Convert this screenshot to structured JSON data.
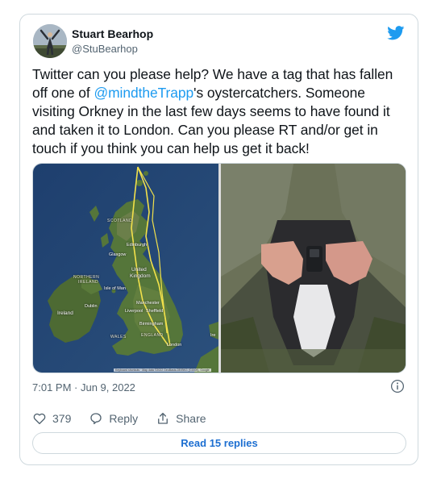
{
  "tweet": {
    "author": {
      "display_name": "Stuart Bearhop",
      "handle": "@StuBearhop"
    },
    "text_part1": "Twitter can you please help? We have a tag that has fallen off one of ",
    "mention": "@mindtheTrapp",
    "text_part2": "'s oystercatchers. Someone visiting Orkney in the last few days seems to have found it and taken it to London. Can you please RT and/or get in touch if you think you can help us get it back!",
    "timestamp": "7:01 PM · Jun 9, 2022",
    "likes_count": "379",
    "reply_label": "Reply",
    "share_label": "Share",
    "read_replies_label": "Read 15 replies"
  },
  "map": {
    "labels": [
      "SCOTLAND",
      "Edinburgh",
      "Glasgow",
      "United",
      "Kingdom",
      "NORTHERN",
      "IRELAND",
      "Isle of Man",
      "Ireland",
      "Dublin",
      "Manchester",
      "Liverpool",
      "Sheffield",
      "Birmingham",
      "WALES",
      "ENGLAND",
      "London",
      "Ire"
    ],
    "attribution": "Keyboard shortcuts · Map data ©2022 GeoBasis-DE/BKG (©2009), Google"
  },
  "colors": {
    "accent": "#1d9bf0",
    "text": "#0f1419",
    "secondary_text": "#536471",
    "border": "#cfd9de",
    "replies_text": "#1d6fd1"
  },
  "icons": [
    "twitter-bird-icon",
    "info-icon",
    "heart-icon",
    "reply-icon",
    "share-icon"
  ]
}
